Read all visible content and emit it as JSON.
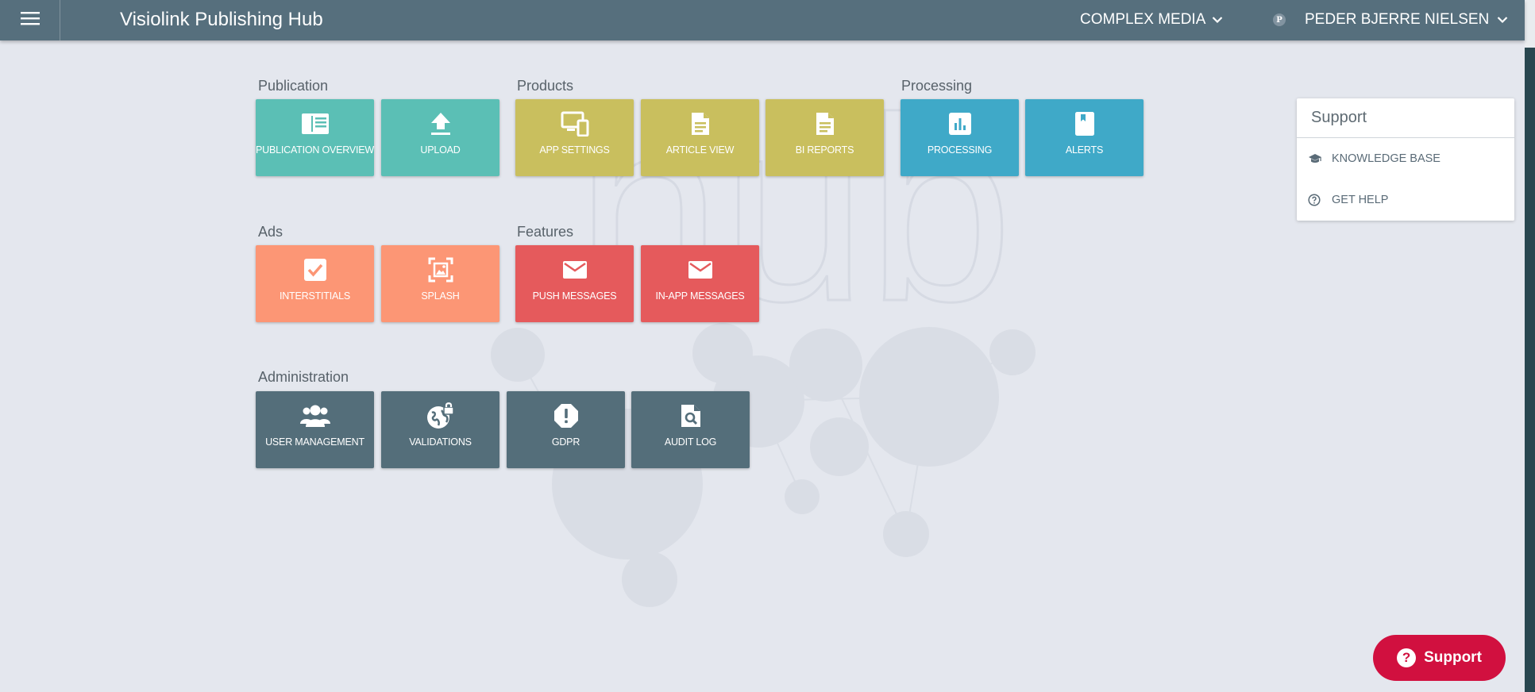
{
  "header": {
    "title": "Visiolink Publishing Hub",
    "organization": "COMPLEX MEDIA",
    "user_initial": "P",
    "user_name": "PEDER BJERRE NIELSEN"
  },
  "watermark": "hub",
  "sections": {
    "publication": {
      "label": "Publication",
      "tiles": [
        {
          "label": "PUBLICATION OVERVIEW",
          "icon": "publication-icon"
        },
        {
          "label": "UPLOAD",
          "icon": "upload-icon"
        }
      ]
    },
    "products": {
      "label": "Products",
      "tiles": [
        {
          "label": "APP SETTINGS",
          "icon": "devices-icon"
        },
        {
          "label": "ARTICLE VIEW",
          "icon": "document-icon"
        },
        {
          "label": "BI REPORTS",
          "icon": "document-icon"
        }
      ]
    },
    "processing": {
      "label": "Processing",
      "tiles": [
        {
          "label": "PROCESSING",
          "icon": "bar-chart-icon"
        },
        {
          "label": "ALERTS",
          "icon": "bookmark-icon"
        }
      ]
    },
    "ads": {
      "label": "Ads",
      "tiles": [
        {
          "label": "INTERSTITIALS",
          "icon": "checkbox-icon"
        },
        {
          "label": "SPLASH",
          "icon": "image-frame-icon"
        }
      ]
    },
    "features": {
      "label": "Features",
      "tiles": [
        {
          "label": "PUSH MESSAGES",
          "icon": "mail-icon"
        },
        {
          "label": "IN-APP MESSAGES",
          "icon": "mail-icon"
        }
      ]
    },
    "administration": {
      "label": "Administration",
      "tiles": [
        {
          "label": "USER MANAGEMENT",
          "icon": "users-icon"
        },
        {
          "label": "VALIDATIONS",
          "icon": "globe-lock-icon"
        },
        {
          "label": "GDPR",
          "icon": "alert-icon"
        },
        {
          "label": "AUDIT LOG",
          "icon": "file-search-icon"
        }
      ]
    }
  },
  "support_panel": {
    "title": "Support",
    "items": [
      {
        "label": "KNOWLEDGE BASE",
        "icon": "graduation-cap-icon"
      },
      {
        "label": "GET HELP",
        "icon": "question-circle-icon"
      }
    ]
  },
  "support_button": {
    "label": "Support",
    "icon_glyph": "?"
  },
  "colors": {
    "header": "#566f7d",
    "background": "#e4e7ee",
    "teal": "#5bbfb5",
    "olive": "#c9bf5e",
    "blue": "#3fa9c8",
    "salmon": "#fc9675",
    "red": "#e55a5c",
    "slate": "#546e7a",
    "support_button": "#d1103f"
  }
}
